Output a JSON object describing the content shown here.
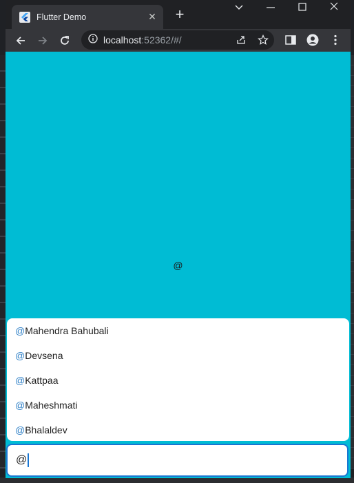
{
  "browser": {
    "tab_title": "Flutter Demo",
    "tab_close": "✕",
    "new_tab": "+",
    "url_host": "localhost",
    "url_rest": ":52362/#/"
  },
  "app": {
    "background_color": "#00bcd4",
    "center_text": "@",
    "suggestions": [
      {
        "at": "@",
        "name": "Mahendra Bahubali"
      },
      {
        "at": "@",
        "name": "Devsena"
      },
      {
        "at": "@",
        "name": "Kattpaa"
      },
      {
        "at": "@",
        "name": "Maheshmati"
      },
      {
        "at": "@",
        "name": "Bhalaldev"
      }
    ],
    "input_value": "@",
    "mention_color": "#2f80c7",
    "focus_color": "#1976d2"
  }
}
